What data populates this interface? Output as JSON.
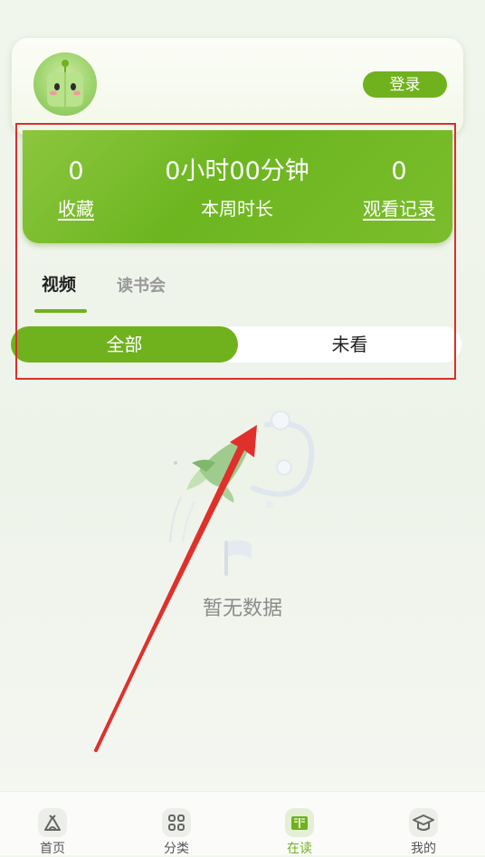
{
  "profile": {
    "login_label": "登录"
  },
  "stats": {
    "favorites_value": "0",
    "favorites_label": "收藏",
    "weekly_time_value": "0小时00分钟",
    "weekly_time_label": "本周时长",
    "history_value": "0",
    "history_label": "观看记录"
  },
  "tabs": [
    {
      "label": "视频",
      "active": true
    },
    {
      "label": "读书会",
      "active": false
    }
  ],
  "filter": {
    "all_label": "全部",
    "unwatched_label": "未看",
    "selected": "全部"
  },
  "empty_state": {
    "text": "暂无数据"
  },
  "bottom_nav": [
    {
      "label": "首页",
      "icon": "home-icon",
      "active": false
    },
    {
      "label": "分类",
      "icon": "category-grid-icon",
      "active": false
    },
    {
      "label": "在读",
      "icon": "book-open-icon",
      "active": true
    },
    {
      "label": "我的",
      "icon": "graduation-cap-icon",
      "active": false
    }
  ],
  "colors": {
    "accent": "#6fb21d",
    "annotation_red": "#d8302b"
  }
}
